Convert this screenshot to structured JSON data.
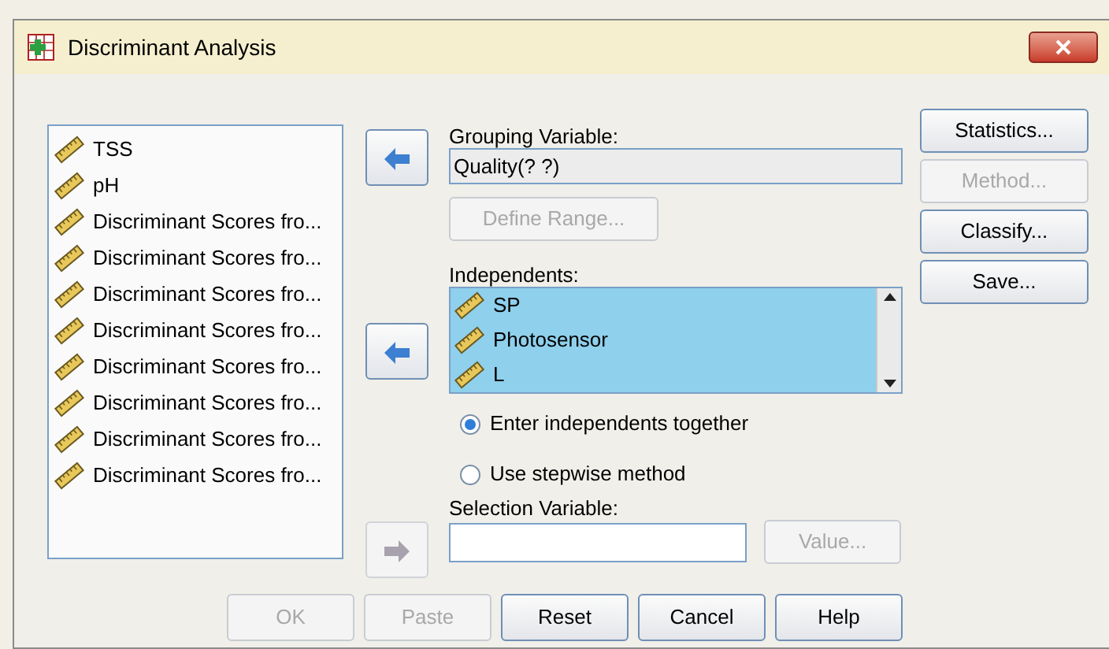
{
  "window": {
    "title": "Discriminant Analysis"
  },
  "variables": [
    {
      "name": "TSS"
    },
    {
      "name": "pH"
    },
    {
      "name": "Discriminant Scores fro..."
    },
    {
      "name": "Discriminant Scores fro..."
    },
    {
      "name": "Discriminant Scores fro..."
    },
    {
      "name": "Discriminant Scores fro..."
    },
    {
      "name": "Discriminant Scores fro..."
    },
    {
      "name": "Discriminant Scores fro..."
    },
    {
      "name": "Discriminant Scores fro..."
    },
    {
      "name": "Discriminant Scores fro..."
    }
  ],
  "move_buttons": [
    {
      "kind": "left",
      "disabled": false
    },
    {
      "kind": "left",
      "disabled": false
    },
    {
      "kind": "right",
      "disabled": true
    }
  ],
  "grouping_variable": {
    "label": "Grouping Variable:",
    "value": "Quality(? ?)"
  },
  "define_range": {
    "label": "Define Range...",
    "disabled": true
  },
  "independents": {
    "label": "Independents:",
    "items": [
      {
        "name": "SP"
      },
      {
        "name": "Photosensor"
      },
      {
        "name": "L"
      }
    ]
  },
  "methods": [
    {
      "label": "Enter independents together",
      "selected": true
    },
    {
      "label": "Use stepwise method",
      "selected": false
    }
  ],
  "selection_variable": {
    "label": "Selection Variable:"
  },
  "value_button": {
    "label": "Value...",
    "disabled": true
  },
  "side_buttons": [
    {
      "label": "Statistics...",
      "disabled": false
    },
    {
      "label": "Method...",
      "disabled": true
    },
    {
      "label": "Classify...",
      "disabled": false
    },
    {
      "label": "Save...",
      "disabled": false
    }
  ],
  "bottom_buttons": [
    {
      "label": "OK",
      "disabled": true
    },
    {
      "label": "Paste",
      "disabled": true
    },
    {
      "label": "Reset",
      "disabled": false
    },
    {
      "label": "Cancel",
      "disabled": false
    },
    {
      "label": "Help",
      "disabled": false
    }
  ]
}
